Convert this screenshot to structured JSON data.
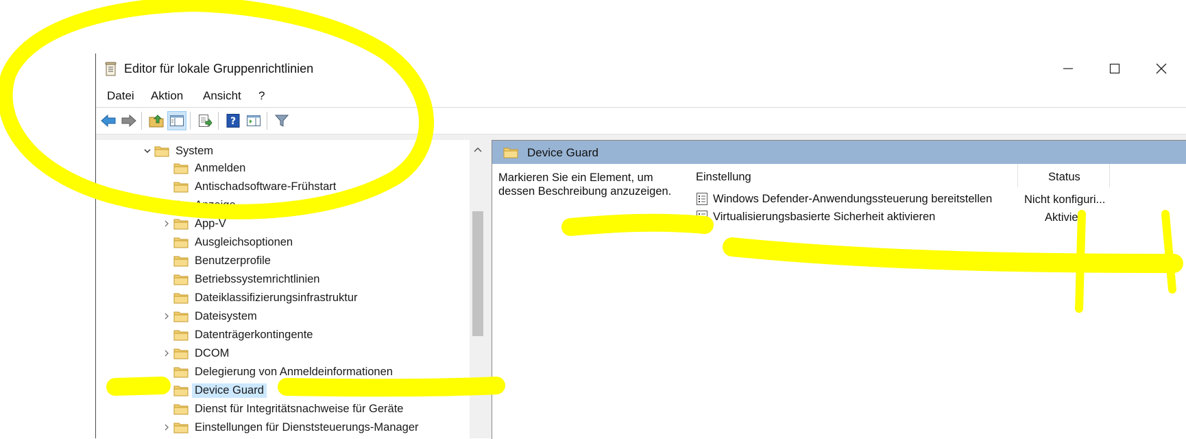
{
  "window": {
    "title": "Editor für lokale Gruppenrichtlinien",
    "controls": [
      "minimize-icon",
      "maximize-icon",
      "close-icon"
    ]
  },
  "menu": [
    "Datei",
    "Aktion",
    "Ansicht",
    "?"
  ],
  "toolbar": [
    "back-arrow-icon",
    "forward-arrow-icon",
    "up-folder-icon",
    "show-hide-tree-icon",
    "export-list-icon",
    "help-icon",
    "properties-pane-icon",
    "filter-icon"
  ],
  "tree": {
    "parent": "System",
    "items": [
      {
        "label": "Anmelden",
        "expandable": false
      },
      {
        "label": "Antischadsoftware-Frühstart",
        "expandable": false
      },
      {
        "label": "Anzeige",
        "expandable": false
      },
      {
        "label": "App-V",
        "expandable": true
      },
      {
        "label": "Ausgleichsoptionen",
        "expandable": false
      },
      {
        "label": "Benutzerprofile",
        "expandable": false
      },
      {
        "label": "Betriebssystemrichtlinien",
        "expandable": false
      },
      {
        "label": "Dateiklassifizierungsinfrastruktur",
        "expandable": false
      },
      {
        "label": "Dateisystem",
        "expandable": true
      },
      {
        "label": "Datenträgerkontingente",
        "expandable": false
      },
      {
        "label": "DCOM",
        "expandable": true
      },
      {
        "label": "Delegierung von Anmeldeinformationen",
        "expandable": false
      },
      {
        "label": "Device Guard",
        "expandable": false,
        "selected": true
      },
      {
        "label": "Dienst für Integritätsnachweise für Geräte",
        "expandable": false
      },
      {
        "label": "Einstellungen für Dienststeuerungs-Manager",
        "expandable": true
      }
    ]
  },
  "details": {
    "header": "Device Guard",
    "description": "Markieren Sie ein Element, um dessen Beschreibung anzuzeigen.",
    "columns": {
      "setting": "Einstellung",
      "status": "Status"
    },
    "policies": [
      {
        "name": "Windows Defender-Anwendungssteuerung bereitstellen",
        "status": "Nicht konfiguri..."
      },
      {
        "name": "Virtualisierungsbasierte Sicherheit aktivieren",
        "status": "Aktiviert"
      }
    ]
  },
  "colors": {
    "header_band": "#98b4d4",
    "selection": "#cce8ff",
    "annotation": "#ffff00"
  }
}
